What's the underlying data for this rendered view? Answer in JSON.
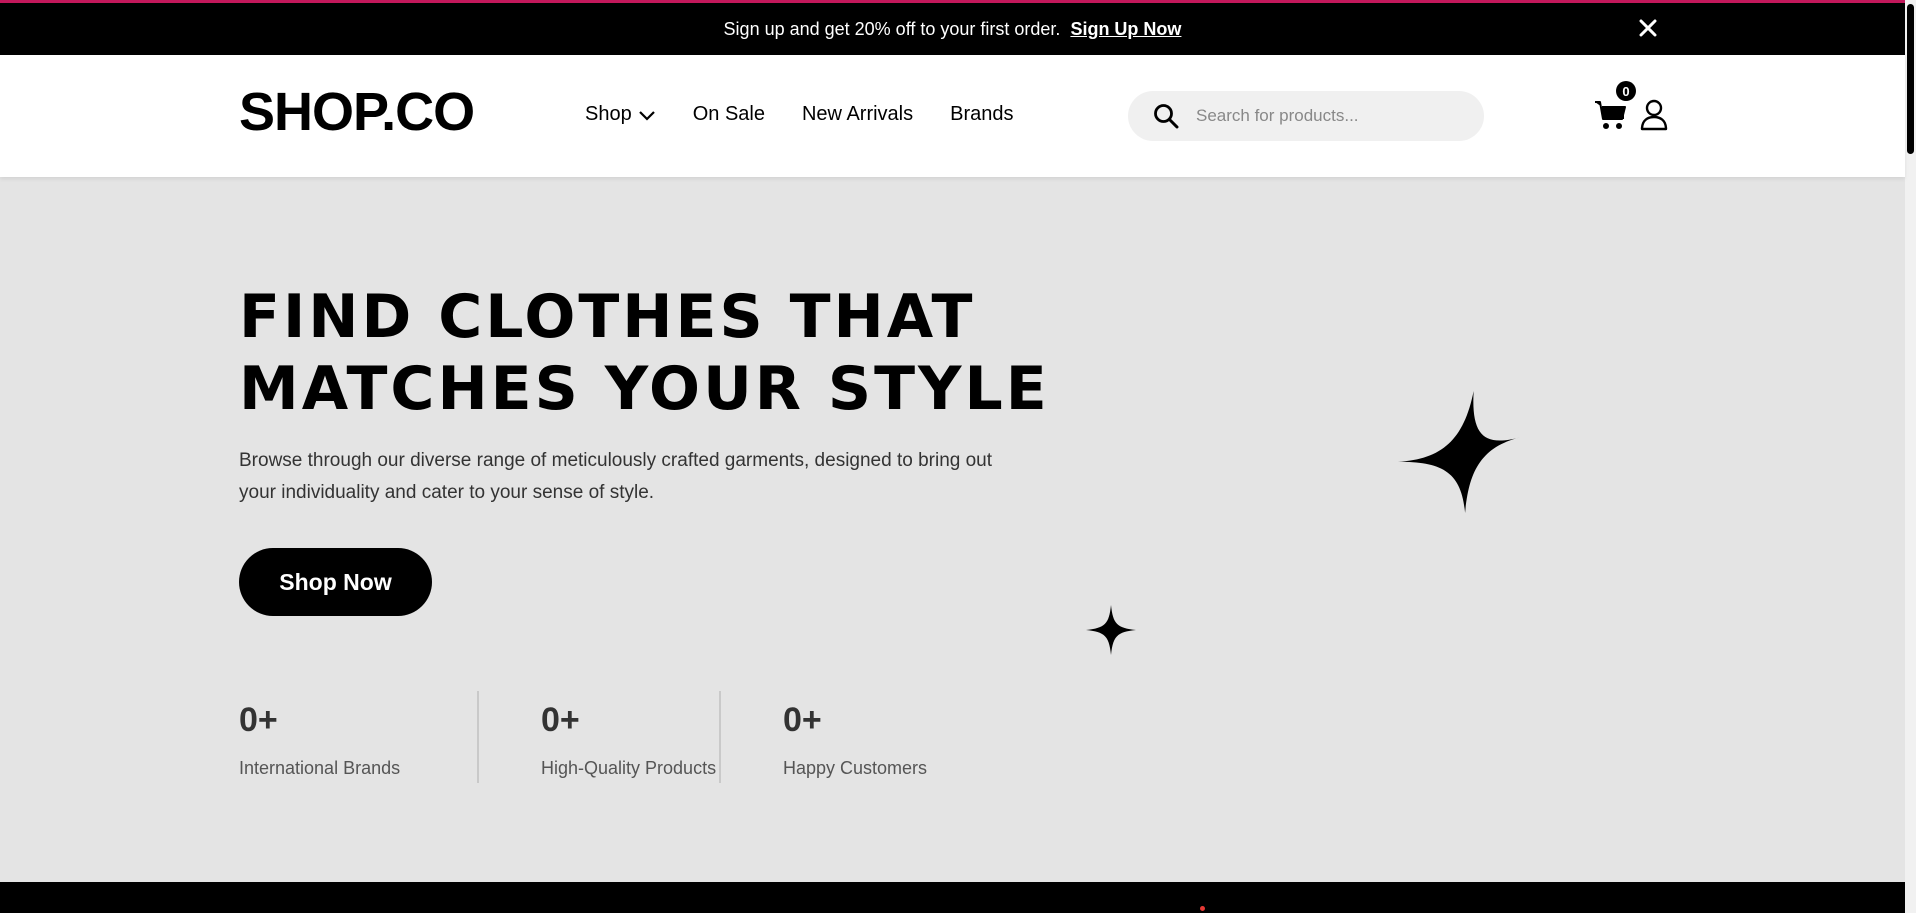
{
  "announcement": {
    "message": "Sign up and get 20% off to your first order.",
    "link_label": "Sign Up Now",
    "close_icon": "close-icon"
  },
  "header": {
    "logo": "SHOP.CO",
    "nav": [
      {
        "label": "Shop",
        "has_dropdown": true
      },
      {
        "label": "On Sale"
      },
      {
        "label": "New Arrivals"
      },
      {
        "label": "Brands"
      }
    ],
    "search": {
      "placeholder": "Search for products...",
      "value": ""
    },
    "cart": {
      "count": "0",
      "icon": "cart-icon"
    },
    "user_icon": "user-icon"
  },
  "hero": {
    "title_line1": "FIND CLOTHES THAT",
    "title_line2": "MATCHES YOUR STYLE",
    "description": "Browse through our diverse range of meticulously crafted garments, designed to bring out your individuality and cater to your sense of style.",
    "cta_label": "Shop Now",
    "stats": [
      {
        "value": "0+",
        "label": "International Brands"
      },
      {
        "value": "0+",
        "label": "High-Quality Products"
      },
      {
        "value": "0+",
        "label": "Happy Customers"
      }
    ],
    "decorations": [
      "sparkle-icon",
      "sparkle-icon"
    ]
  },
  "colors": {
    "announcement_bg": "#000000",
    "hero_bg": "#e4e4e4",
    "accent_line": "#c2185b",
    "cta_bg": "#000000"
  }
}
